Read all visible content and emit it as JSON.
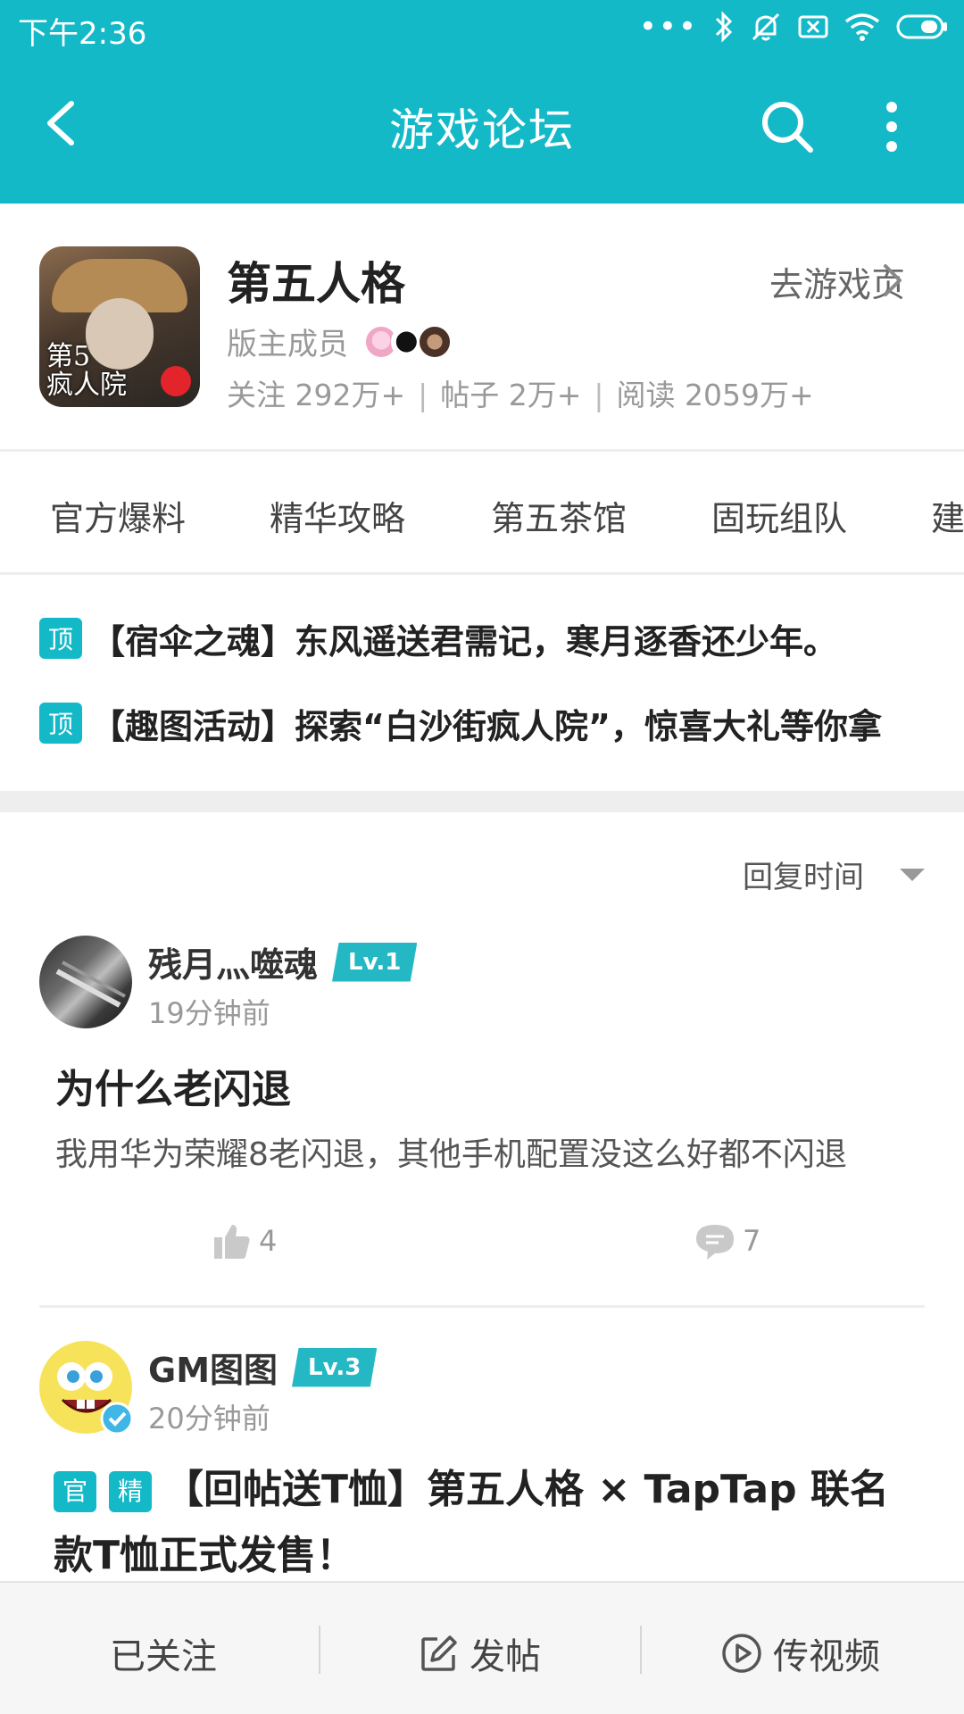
{
  "status_bar": {
    "time": "下午2:36",
    "icons": [
      "more-dots-icon",
      "bluetooth-icon",
      "mute-icon",
      "sim-off-icon",
      "wifi-icon",
      "battery-icon"
    ]
  },
  "app_bar": {
    "title": "游戏论坛"
  },
  "game": {
    "name": "第五人格",
    "goto_label": "去游戏页",
    "cover_text": "第5\n疯人院",
    "moderators_label": "版主成员",
    "stats": {
      "follow": "关注 292万+",
      "posts": "帖子 2万+",
      "reads": "阅读 2059万+"
    }
  },
  "tabs": [
    "官方爆料",
    "精华攻略",
    "第五茶馆",
    "固玩组队",
    "建"
  ],
  "pinned": [
    {
      "badge": "顶",
      "text": "【宿伞之魂】东风遥送君需记，寒月逐香还少年。"
    },
    {
      "badge": "顶",
      "text": "【趣图活动】探索“白沙街疯人院”，惊喜大礼等你拿"
    }
  ],
  "sort": {
    "label": "回复时间"
  },
  "posts": [
    {
      "username": "残月灬噬魂",
      "level": "Lv.1",
      "time": "19分钟前",
      "title": "为什么老闪退",
      "excerpt": "我用华为荣耀8老闪退，其他手机配置没这么好都不闪退",
      "likes": "4",
      "comments": "7"
    },
    {
      "username": "GM图图",
      "level": "Lv.3",
      "time": "20分钟前",
      "tags": [
        "官",
        "精"
      ],
      "title": "【回帖送T恤】第五人格 × TapTap 联名款T恤正式发售！"
    }
  ],
  "bottom_bar": {
    "follow": "已关注",
    "post": "发帖",
    "video": "传视频"
  },
  "colors": {
    "accent": "#14b9c8",
    "level_badge": "#24b8c4",
    "divider": "#eeeeee"
  }
}
